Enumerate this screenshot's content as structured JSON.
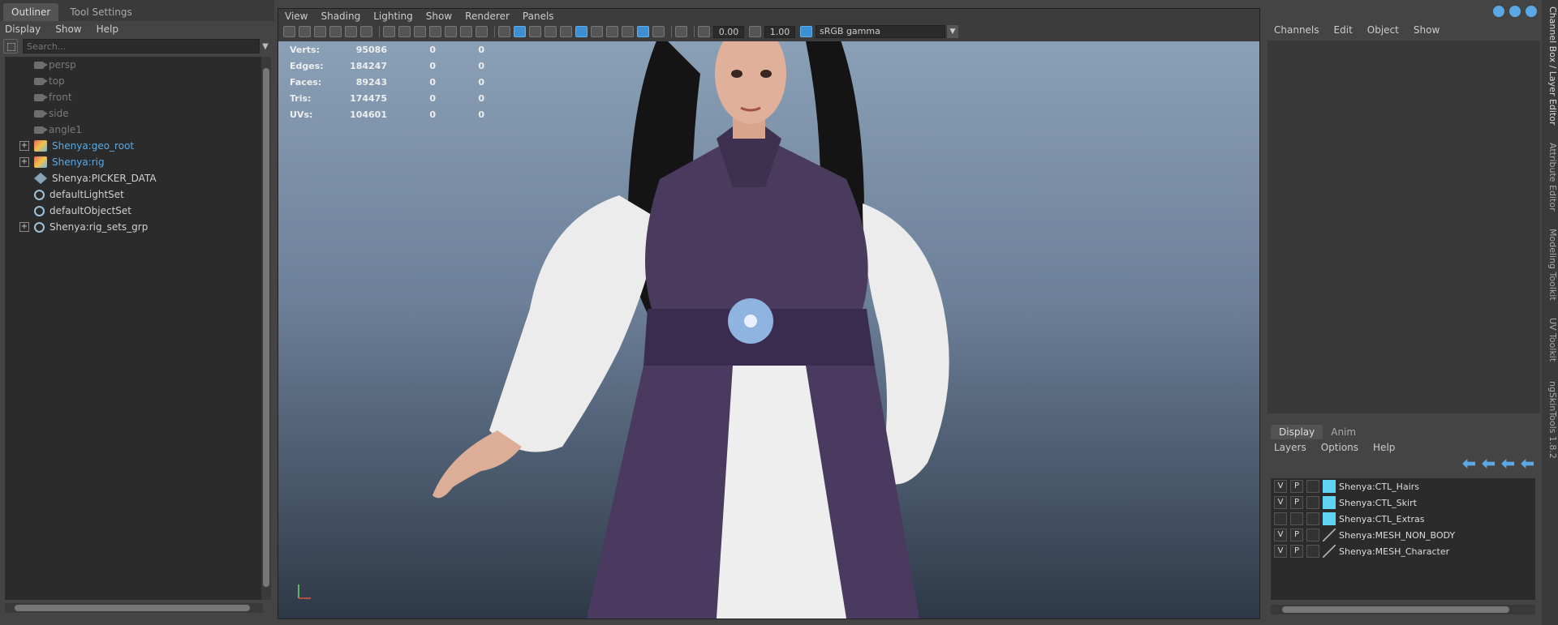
{
  "outliner": {
    "tabs": [
      "Outliner",
      "Tool Settings"
    ],
    "menu": [
      "Display",
      "Show",
      "Help"
    ],
    "search_placeholder": "Search...",
    "items": [
      {
        "label": "persp",
        "style": "dim",
        "icon": "camera-icon",
        "expand": false
      },
      {
        "label": "top",
        "style": "dim",
        "icon": "camera-icon",
        "expand": false
      },
      {
        "label": "front",
        "style": "dim",
        "icon": "camera-icon",
        "expand": false
      },
      {
        "label": "side",
        "style": "dim",
        "icon": "camera-icon",
        "expand": false
      },
      {
        "label": "angle1",
        "style": "dim",
        "icon": "camera-icon",
        "expand": false
      },
      {
        "label": "Shenya:geo_root",
        "style": "blue",
        "icon": "group-icon",
        "expand": true
      },
      {
        "label": "Shenya:rig",
        "style": "blue",
        "icon": "group-icon",
        "expand": true
      },
      {
        "label": "Shenya:PICKER_DATA",
        "style": "norm",
        "icon": "picker-icon",
        "expand": false
      },
      {
        "label": "defaultLightSet",
        "style": "norm",
        "icon": "set-icon",
        "expand": false
      },
      {
        "label": "defaultObjectSet",
        "style": "norm",
        "icon": "set-icon",
        "expand": false
      },
      {
        "label": "Shenya:rig_sets_grp",
        "style": "norm",
        "icon": "set-icon",
        "expand": true
      }
    ]
  },
  "viewport": {
    "menu": [
      "View",
      "Shading",
      "Lighting",
      "Show",
      "Renderer",
      "Panels"
    ],
    "exposure": "0.00",
    "gamma": "1.00",
    "colorspace": "sRGB gamma",
    "hud": [
      {
        "label": "Verts:",
        "value": "95086",
        "sel": "0",
        "comp": "0"
      },
      {
        "label": "Edges:",
        "value": "184247",
        "sel": "0",
        "comp": "0"
      },
      {
        "label": "Faces:",
        "value": "89243",
        "sel": "0",
        "comp": "0"
      },
      {
        "label": "Tris:",
        "value": "174475",
        "sel": "0",
        "comp": "0"
      },
      {
        "label": "UVs:",
        "value": "104601",
        "sel": "0",
        "comp": "0"
      }
    ]
  },
  "channelbox": {
    "menu": [
      "Channels",
      "Edit",
      "Object",
      "Show"
    ],
    "layer_tabs": [
      "Display",
      "Anim"
    ],
    "layer_menu": [
      "Layers",
      "Options",
      "Help"
    ],
    "layers": [
      {
        "v": "V",
        "p": "P",
        "color": "#5fd3f3",
        "name": "Shenya:CTL_Hairs"
      },
      {
        "v": "V",
        "p": "P",
        "color": "#5fd3f3",
        "name": "Shenya:CTL_Skirt"
      },
      {
        "v": "",
        "p": "",
        "color": "#5fd3f3",
        "name": "Shenya:CTL_Extras"
      },
      {
        "v": "V",
        "p": "P",
        "color": "",
        "name": "Shenya:MESH_NON_BODY"
      },
      {
        "v": "V",
        "p": "P",
        "color": "",
        "name": "Shenya:MESH_Character"
      }
    ]
  },
  "side_tabs": [
    "Channel Box / Layer Editor",
    "Attribute Editor",
    "Modeling Toolkit",
    "UV Toolkit",
    "ngSkinTools 1.8.2"
  ],
  "colors": {
    "accent": "#5aa9e6",
    "panel": "#444444",
    "field": "#2b2b2b"
  }
}
